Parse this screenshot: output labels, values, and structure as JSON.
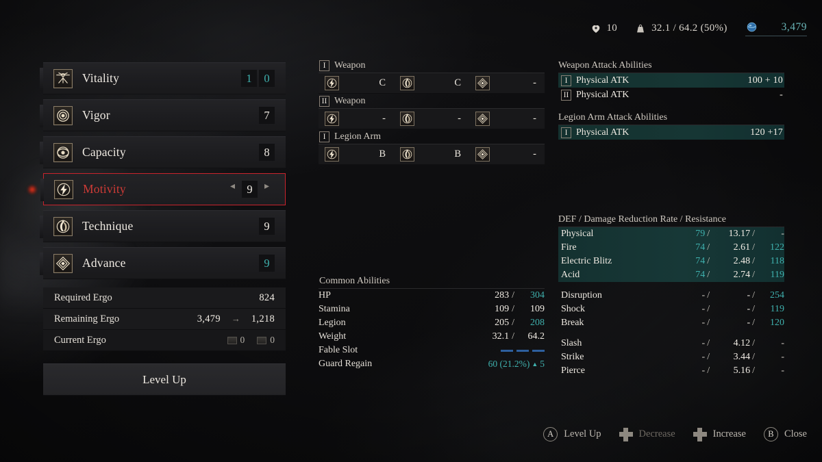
{
  "topbar": {
    "humanity": {
      "icon": "heart-icon",
      "value": "10"
    },
    "weight": {
      "icon": "weight-icon",
      "value": "32.1 / 64.2 (50%)"
    },
    "ergo": {
      "icon": "ergo-orb-icon",
      "value": "3,479"
    }
  },
  "stats": {
    "rows": [
      {
        "icon": "vitality-icon",
        "label": "Vitality",
        "value": "10",
        "digits": [
          "1",
          "0"
        ],
        "teal": true,
        "selected": false
      },
      {
        "icon": "vigor-icon",
        "label": "Vigor",
        "value": "7",
        "digits": [
          "7"
        ],
        "teal": false,
        "selected": false
      },
      {
        "icon": "capacity-icon",
        "label": "Capacity",
        "value": "8",
        "digits": [
          "8"
        ],
        "teal": false,
        "selected": false
      },
      {
        "icon": "motivity-icon",
        "label": "Motivity",
        "value": "9",
        "digits": [
          "9"
        ],
        "teal": false,
        "selected": true
      },
      {
        "icon": "technique-icon",
        "label": "Technique",
        "value": "9",
        "digits": [
          "9"
        ],
        "teal": false,
        "selected": false
      },
      {
        "icon": "advance-icon",
        "label": "Advance",
        "value": "9",
        "digits": [
          "9"
        ],
        "teal": true,
        "selected": false
      }
    ],
    "decrease_arrow": "◂",
    "increase_arrow": "▸"
  },
  "ergo_panel": {
    "required_label": "Required Ergo",
    "required_value": "824",
    "remaining_label": "Remaining Ergo",
    "remaining_before": "3,479",
    "remaining_arrow": "→",
    "remaining_after": "1,218",
    "current_label": "Current Ergo",
    "current_items": [
      {
        "icon": "ergo-chunk-icon",
        "value": "0"
      },
      {
        "icon": "ergo-fragment-icon",
        "value": "0"
      }
    ],
    "level_up_button": "Level Up"
  },
  "scaling": {
    "sections": [
      {
        "numeral": "I",
        "title": "Weapon",
        "entries": [
          {
            "icon": "motivity-icon",
            "grade": "C"
          },
          {
            "icon": "technique-icon",
            "grade": "C"
          },
          {
            "icon": "advance-icon",
            "grade": "-"
          }
        ]
      },
      {
        "numeral": "II",
        "title": "Weapon",
        "entries": [
          {
            "icon": "motivity-icon",
            "grade": "-"
          },
          {
            "icon": "technique-icon",
            "grade": "-"
          },
          {
            "icon": "advance-icon",
            "grade": "-"
          }
        ]
      },
      {
        "numeral": "I",
        "title": "Legion Arm",
        "entries": [
          {
            "icon": "motivity-icon",
            "grade": "B"
          },
          {
            "icon": "technique-icon",
            "grade": "B"
          },
          {
            "icon": "advance-icon",
            "grade": "-"
          }
        ]
      }
    ]
  },
  "common_abilities": {
    "title": "Common Abilities",
    "rows": [
      {
        "label": "HP",
        "current": "283",
        "sep": "/",
        "max": "304",
        "max_teal": true
      },
      {
        "label": "Stamina",
        "current": "109",
        "sep": "/",
        "max": "109",
        "max_teal": false
      },
      {
        "label": "Legion",
        "current": "205",
        "sep": "/",
        "max": "208",
        "max_teal": true
      },
      {
        "label": "Weight",
        "current": "32.1",
        "sep": "/",
        "max": "64.2",
        "max_teal": false
      }
    ],
    "fable_slot_label": "Fable Slot",
    "fable_slot_count": 3,
    "guard_regain_label": "Guard Regain",
    "guard_regain_value": "60 (21.2%)",
    "guard_regain_up_icon": "▲",
    "guard_regain_delta": "5"
  },
  "weapon_attack": {
    "title": "Weapon Attack Abilities",
    "rows": [
      {
        "numeral": "I",
        "label": "Physical ATK",
        "value": "100 + 10",
        "highlight": true
      },
      {
        "numeral": "II",
        "label": "Physical ATK",
        "value": "-",
        "highlight": false
      }
    ]
  },
  "legion_attack": {
    "title": "Legion Arm Attack Abilities",
    "rows": [
      {
        "numeral": "I",
        "label": "Physical ATK",
        "value": "120 +17",
        "highlight": true
      }
    ]
  },
  "defense": {
    "title": "DEF / Damage Reduction Rate / Resistance",
    "group_a": [
      {
        "label": "Physical",
        "def": "79",
        "def_teal": true,
        "rate": "13.17",
        "res": "-",
        "res_teal": false,
        "highlight": true
      },
      {
        "label": "Fire",
        "def": "74",
        "def_teal": true,
        "rate": "2.61",
        "res": "122",
        "res_teal": true,
        "highlight": true
      },
      {
        "label": "Electric Blitz",
        "def": "74",
        "def_teal": true,
        "rate": "2.48",
        "res": "118",
        "res_teal": true,
        "highlight": true
      },
      {
        "label": "Acid",
        "def": "74",
        "def_teal": true,
        "rate": "2.74",
        "res": "119",
        "res_teal": true,
        "highlight": true
      }
    ],
    "group_b": [
      {
        "label": "Disruption",
        "def": "-",
        "def_teal": false,
        "rate": "-",
        "res": "254",
        "res_teal": true,
        "highlight": false
      },
      {
        "label": "Shock",
        "def": "-",
        "def_teal": false,
        "rate": "-",
        "res": "119",
        "res_teal": true,
        "highlight": false
      },
      {
        "label": "Break",
        "def": "-",
        "def_teal": false,
        "rate": "-",
        "res": "120",
        "res_teal": true,
        "highlight": false
      }
    ],
    "group_c": [
      {
        "label": "Slash",
        "def": "-",
        "def_teal": false,
        "rate": "4.12",
        "res": "-",
        "res_teal": false,
        "highlight": false
      },
      {
        "label": "Strike",
        "def": "-",
        "def_teal": false,
        "rate": "3.44",
        "res": "-",
        "res_teal": false,
        "highlight": false
      },
      {
        "label": "Pierce",
        "def": "-",
        "def_teal": false,
        "rate": "5.16",
        "res": "-",
        "res_teal": false,
        "highlight": false
      }
    ],
    "separator": "/"
  },
  "prompts": [
    {
      "button": "A",
      "kind": "round",
      "label": "Level Up",
      "dim": false
    },
    {
      "button": "",
      "kind": "dpad",
      "label": "Decrease",
      "dim": true
    },
    {
      "button": "",
      "kind": "dpad",
      "label": "Increase",
      "dim": false
    },
    {
      "button": "B",
      "kind": "round",
      "label": "Close",
      "dim": false
    }
  ],
  "colors": {
    "teal": "#3fb1ae",
    "selection_red": "#c9232c",
    "highlight_green": "#163634",
    "fable_blue": "#2d5f9e"
  }
}
